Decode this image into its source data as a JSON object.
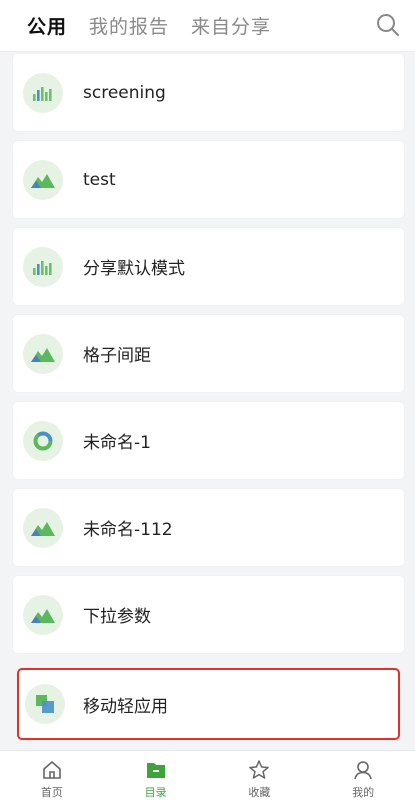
{
  "header": {
    "tabs": [
      {
        "label": "公用",
        "active": true
      },
      {
        "label": "我的报告",
        "active": false
      },
      {
        "label": "来自分享",
        "active": false
      }
    ],
    "search_icon": "search-icon"
  },
  "reports": [
    {
      "label": "screening",
      "icon": "bar-chart-icon"
    },
    {
      "label": "test",
      "icon": "area-chart-icon"
    },
    {
      "label": "分享默认模式",
      "icon": "bar-chart-icon"
    },
    {
      "label": "格子间距",
      "icon": "area-chart-icon"
    },
    {
      "label": "未命名-1",
      "icon": "donut-chart-icon"
    },
    {
      "label": "未命名-112",
      "icon": "area-chart-icon"
    },
    {
      "label": "下拉参数",
      "icon": "area-chart-icon"
    },
    {
      "label": "移动轻应用",
      "icon": "app-squares-icon",
      "selected": true
    }
  ],
  "tabbar": [
    {
      "label": "首页",
      "icon": "home-icon",
      "active": false
    },
    {
      "label": "目录",
      "icon": "catalog-folder-icon",
      "active": true
    },
    {
      "label": "收藏",
      "icon": "star-icon",
      "active": false
    },
    {
      "label": "我的",
      "icon": "user-icon",
      "active": false
    }
  ],
  "colors": {
    "accent": "#3fa33b",
    "highlight_border": "#e0322a",
    "icon_bg": "#e6f2e3"
  }
}
